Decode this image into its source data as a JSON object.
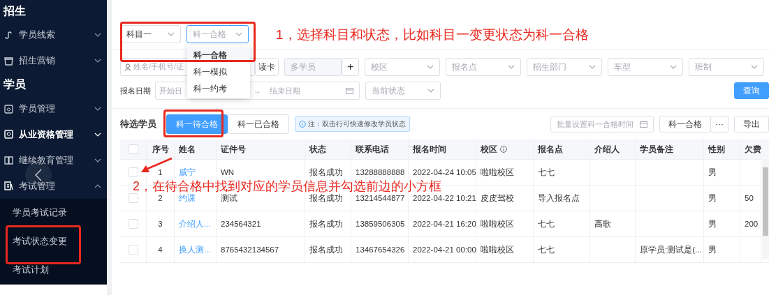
{
  "sidebar": {
    "items": [
      {
        "kind": "heading",
        "label": "招生"
      },
      {
        "kind": "item",
        "label": "学员线索",
        "expanded": false,
        "active": false
      },
      {
        "kind": "item",
        "label": "招生营销",
        "expanded": false,
        "active": false
      },
      {
        "kind": "heading",
        "label": "学员"
      },
      {
        "kind": "item",
        "label": "学员管理",
        "expanded": false,
        "active": false
      },
      {
        "kind": "item",
        "label": "从业资格管理",
        "expanded": false,
        "active": true
      },
      {
        "kind": "item",
        "label": "继续教育管理",
        "expanded": false,
        "active": false
      },
      {
        "kind": "item",
        "label": "考试管理",
        "expanded": true,
        "active": false,
        "children": [
          {
            "label": "学员考试记录"
          },
          {
            "label": "考试状态变更"
          },
          {
            "label": "考试计划"
          }
        ]
      }
    ]
  },
  "top_selects": [
    {
      "value": "科目一",
      "focused": false
    },
    {
      "placeholder": "科一合格",
      "focused": true
    }
  ],
  "dropdown": {
    "options": [
      {
        "label": "科一合格",
        "selected": true
      },
      {
        "label": "科一模拟",
        "selected": false
      },
      {
        "label": "科一约考",
        "selected": false
      }
    ]
  },
  "filters": {
    "search": {
      "placeholder": "姓名/手机号/证"
    },
    "read_card": "读卡",
    "multi": {
      "placeholder": "多学员",
      "add": "+"
    },
    "selects": [
      {
        "placeholder": "校区"
      },
      {
        "placeholder": "报名点"
      },
      {
        "placeholder": "招生部门"
      },
      {
        "placeholder": "车型"
      },
      {
        "placeholder": "班制"
      }
    ],
    "date_label": "报名日期",
    "date_start": "开始日",
    "date_separator": "→",
    "date_end": "结束日期",
    "status_select": {
      "placeholder": "当前状态"
    },
    "query": "查询"
  },
  "toolbar": {
    "title": "待选学员",
    "tabs": [
      {
        "label": "科一待合格",
        "selected": true
      },
      {
        "label": "科一已合格",
        "selected": false
      }
    ],
    "note": "注：双击行可快速修改学员状态",
    "batch_date": {
      "placeholder": "批量设置科一合格时间"
    },
    "status_button": "科一合格",
    "more": "···",
    "export": "导出"
  },
  "table": {
    "all_checked": false,
    "columns": [
      {
        "label": "序号"
      },
      {
        "label": "姓名"
      },
      {
        "label": "证件号"
      },
      {
        "label": "状态"
      },
      {
        "label": "联系电话"
      },
      {
        "label": "报名时间"
      },
      {
        "label": "校区",
        "hint": true
      },
      {
        "label": "报名点"
      },
      {
        "label": "介绍人"
      },
      {
        "label": "学员备注"
      },
      {
        "label": "性别"
      },
      {
        "label": "欠费"
      }
    ],
    "rows": [
      {
        "checked": false,
        "no": "1",
        "name": "威宁",
        "id_no": "WN",
        "status": "报名成功",
        "phone": "13288888888",
        "time": "2022-04-24 10:05",
        "campus": "啦啦校区",
        "site": "七七",
        "gender": "男"
      },
      {
        "checked": false,
        "no": "2",
        "name": "约课",
        "id_no": "测试",
        "status": "报名成功",
        "phone": "13214544877",
        "time": "2022-04-22 10:21",
        "campus": "皮皮驾校",
        "site": "导入报名点",
        "gender": "男",
        "owed": "50"
      },
      {
        "checked": false,
        "no": "3",
        "name": "介绍人...",
        "id_no": "234564321",
        "status": "报名成功",
        "phone": "13859506305",
        "time": "2022-04-21 16:20",
        "campus": "啦啦校区",
        "site": "七七",
        "referrer": "高歌",
        "gender": "男",
        "owed": "200"
      },
      {
        "checked": false,
        "no": "4",
        "name": "换人测...",
        "id_no": "8765432134567",
        "status": "报名成功",
        "phone": "13467654326",
        "time": "2022-04-21 00:00",
        "campus": "啦啦校区",
        "site": "七七",
        "remark": "原学员:测试是(...",
        "gender": "男"
      }
    ]
  },
  "annotations": [
    {
      "text": "1，选择科目和状态，比如科目一变更状态为科一合格"
    },
    {
      "text": "2，在待合格中找到对应的学员信息并勾选前边的小方框"
    }
  ]
}
